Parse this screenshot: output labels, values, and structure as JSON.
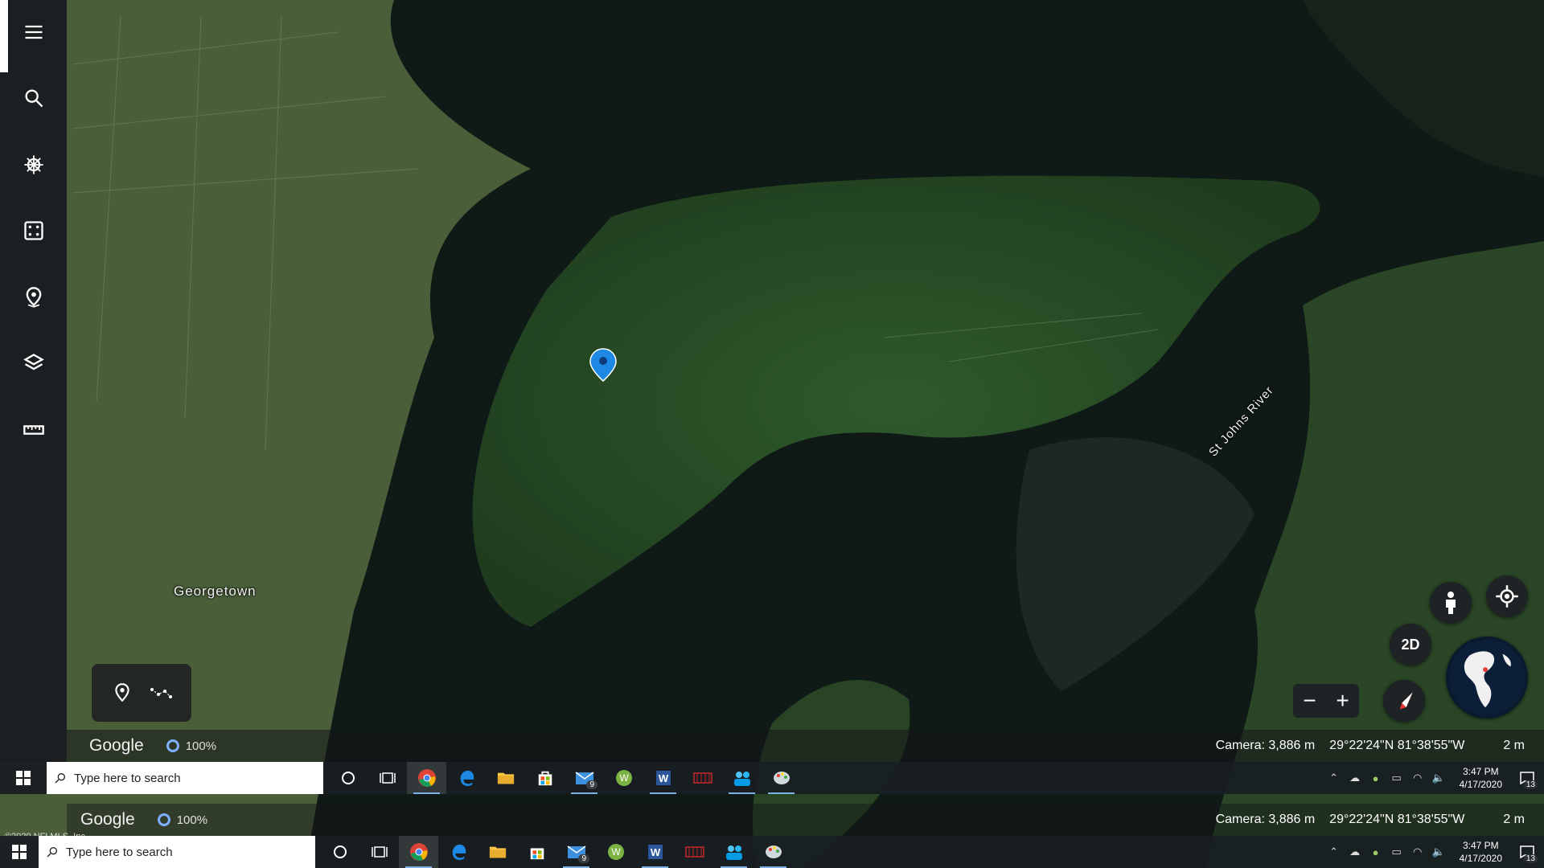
{
  "sidebar": {
    "items": [
      {
        "name": "menu",
        "icon": "menu-icon"
      },
      {
        "name": "search",
        "icon": "search-icon"
      },
      {
        "name": "voyager",
        "icon": "ship-wheel-icon"
      },
      {
        "name": "feeling-lucky",
        "icon": "dice-icon"
      },
      {
        "name": "projects",
        "icon": "map-pin-icon"
      },
      {
        "name": "map-style",
        "icon": "layers-icon"
      },
      {
        "name": "measure",
        "icon": "ruler-icon"
      }
    ]
  },
  "map": {
    "labels": {
      "town": "Georgetown",
      "river": "St Johns River"
    },
    "copyright": "©2020 NFLMLS, Inc."
  },
  "controls": {
    "two_d": "2D",
    "zoom_out": "−",
    "zoom_in": "+"
  },
  "statusbar": {
    "logo": "Google",
    "load_pct": "100%",
    "camera": "Camera: 3,886 m",
    "coords": "29°22'24\"N 81°38'55\"W",
    "scale": "2 m"
  },
  "taskbar": {
    "search_placeholder": "Type here to search",
    "mail_badge": "9",
    "time": "3:47 PM",
    "date": "4/17/2020",
    "notifications": "13"
  },
  "colors": {
    "accent": "#7db0ff",
    "pin": "#1e88e5"
  }
}
